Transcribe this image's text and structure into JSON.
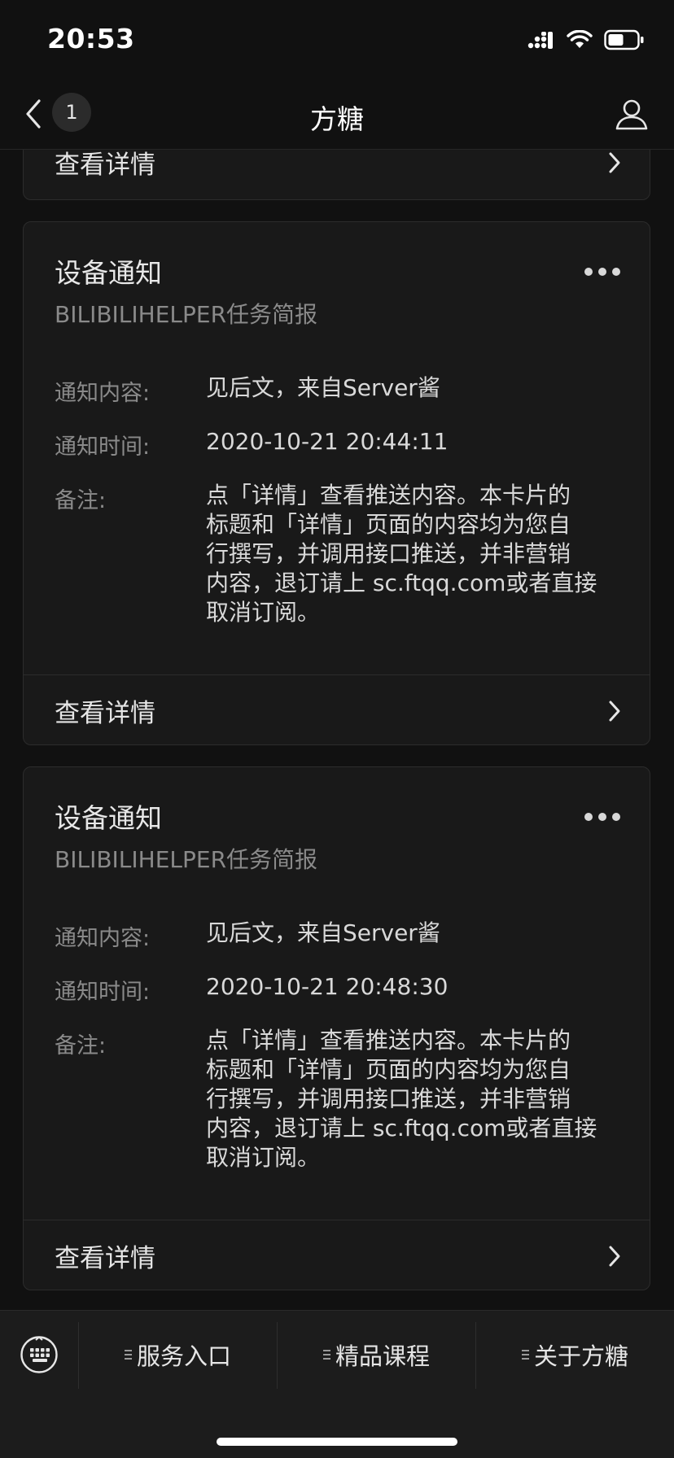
{
  "status_bar": {
    "time": "20:53",
    "icons": [
      "signal-icon",
      "wifi-icon",
      "battery-icon"
    ]
  },
  "nav": {
    "back_icon": "chevron-left-icon",
    "badge_count": "1",
    "title": "方糖",
    "profile_icon": "user-icon"
  },
  "cards": [
    {
      "footer_label": "查看详情"
    },
    {
      "title": "设备通知",
      "subtitle": "BILIBILIHELPER任务简报",
      "rows": [
        {
          "label": "通知内容:",
          "value": "见后文，来自Server酱"
        },
        {
          "label": "通知时间:",
          "value": "2020-10-21 20:44:11"
        },
        {
          "label": "备注:",
          "value_lines": [
            "点「详情」查看推送内容。本卡片的",
            "标题和「详情」页面的内容均为您自",
            "行撰写，并调用接口推送，并非营销",
            "内容，退订请上 sc.ftqq.com或者直接",
            "取消订阅。"
          ]
        }
      ],
      "footer_label": "查看详情"
    },
    {
      "title": "设备通知",
      "subtitle": "BILIBILIHELPER任务简报",
      "rows": [
        {
          "label": "通知内容:",
          "value": "见后文，来自Server酱"
        },
        {
          "label": "通知时间:",
          "value": "2020-10-21 20:48:30"
        },
        {
          "label": "备注:",
          "value_lines": [
            "点「详情」查看推送内容。本卡片的",
            "标题和「详情」页面的内容均为您自",
            "行撰写，并调用接口推送，并非营销",
            "内容，退订请上 sc.ftqq.com或者直接",
            "取消订阅。"
          ]
        }
      ],
      "footer_label": "查看详情"
    }
  ],
  "bottom_menu": {
    "keyboard_icon": "keyboard-icon",
    "items": [
      {
        "label": "服务入口"
      },
      {
        "label": "精品课程"
      },
      {
        "label": "关于方糖"
      }
    ]
  },
  "colors": {
    "background": "#111111",
    "card": "#191919",
    "text_primary": "#e6e6e6",
    "text_secondary": "#8a8a8a"
  }
}
